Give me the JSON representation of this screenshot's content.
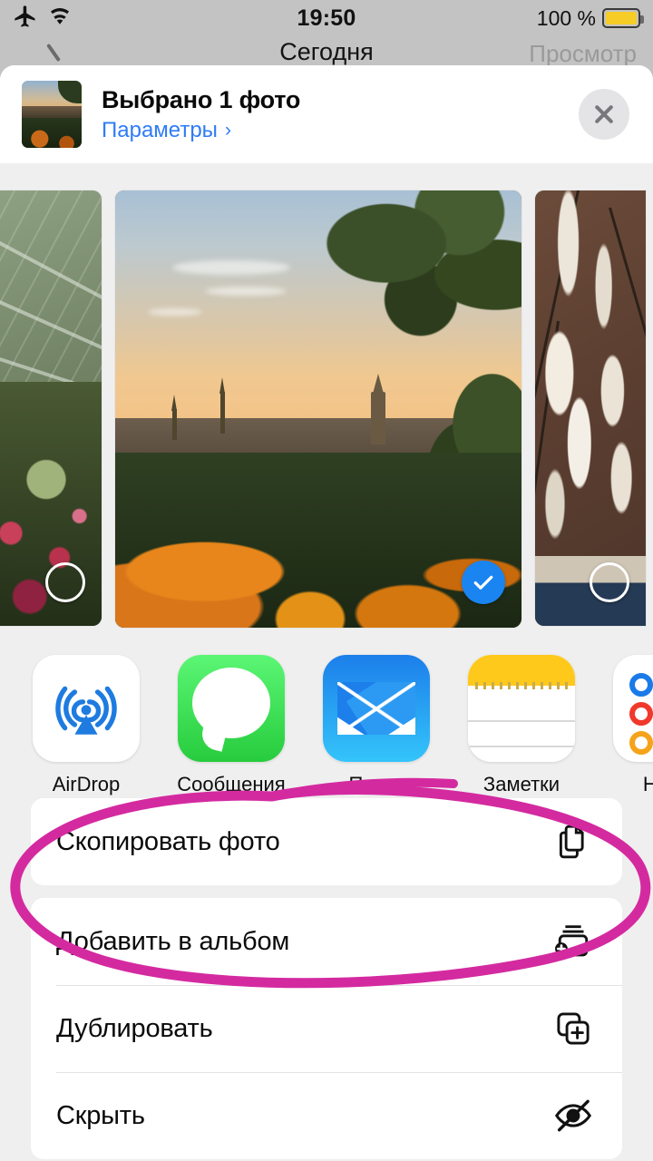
{
  "status_bar": {
    "airplane_icon": "airplane-icon",
    "wifi_icon": "wifi-icon",
    "time": "19:50",
    "battery_percent": "100 %",
    "battery_color": "#F6CC26"
  },
  "background_app": {
    "title": "Сегодня",
    "right_action": "Просмотр",
    "back_icon": "back-chevron-icon"
  },
  "share_sheet": {
    "header": {
      "title": "Выбрано 1 фото",
      "options_link": "Параметры",
      "chevron": "›",
      "close_icon": "close-icon"
    },
    "photos": [
      {
        "name": "greenhouse-photo",
        "selected": false
      },
      {
        "name": "city-sunset-photo",
        "selected": true
      },
      {
        "name": "magnolia-photo",
        "selected": false
      }
    ],
    "apps": [
      {
        "label": "AirDrop",
        "icon": "airdrop-icon"
      },
      {
        "label": "Сообщения",
        "icon": "messages-icon"
      },
      {
        "label": "Почта",
        "icon": "mail-icon"
      },
      {
        "label": "Заметки",
        "icon": "notes-icon"
      },
      {
        "label": "Напо",
        "icon": "reminders-icon"
      }
    ],
    "actions": [
      {
        "label": "Скопировать фото",
        "icon": "copy-icon",
        "highlighted": true
      },
      {
        "label": "Добавить в альбом",
        "icon": "add-to-album-icon",
        "highlighted": false
      },
      {
        "label": "Дублировать",
        "icon": "duplicate-icon",
        "highlighted": false
      },
      {
        "label": "Скрыть",
        "icon": "hide-eye-slash-icon",
        "highlighted": false
      }
    ]
  },
  "annotation": {
    "shape": "hand-drawn-ellipse",
    "color": "#D42AA0",
    "target": "Скопировать фото"
  },
  "colors": {
    "accent_blue": "#2F7CF6",
    "selection_blue": "#1A84F0",
    "sheet_background": "#EFEFEF",
    "card_background": "#FFFFFF",
    "annotation_magenta": "#D42AA0"
  }
}
